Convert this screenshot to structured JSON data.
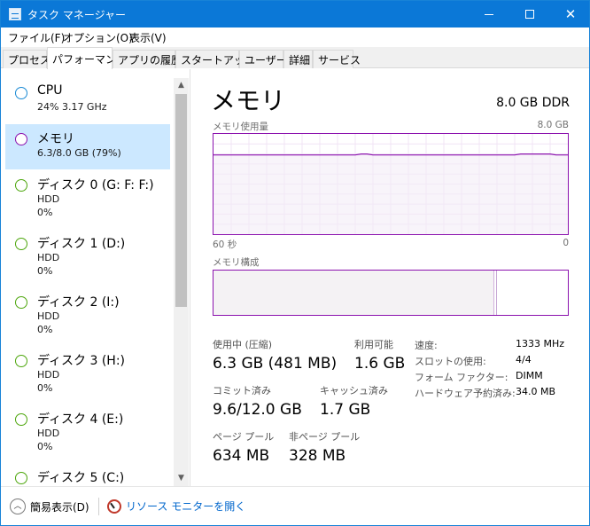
{
  "window": {
    "title": "タスク マネージャー",
    "close_glyph": "✕"
  },
  "menu": [
    "ファイル(F)",
    "オプション(O)",
    "表示(V)"
  ],
  "tabs": [
    "プロセス",
    "パフォーマンス",
    "アプリの履歴",
    "スタートアップ",
    "ユーザー",
    "詳細",
    "サービス"
  ],
  "active_tab": "パフォーマンス",
  "sidebar": {
    "items": [
      {
        "title": "CPU",
        "sub1": "24%  3.17 GHz",
        "sub2": "",
        "color": "#1a8ad4",
        "selected": false
      },
      {
        "title": "メモリ",
        "sub1": "6.3/8.0 GB (79%)",
        "sub2": "",
        "color": "#8b12ae",
        "selected": true
      },
      {
        "title": "ディスク 0 (G: F: F:)",
        "sub1": "HDD",
        "sub2": "0%",
        "color": "#4da60c",
        "selected": false
      },
      {
        "title": "ディスク 1 (D:)",
        "sub1": "HDD",
        "sub2": "0%",
        "color": "#4da60c",
        "selected": false
      },
      {
        "title": "ディスク 2 (I:)",
        "sub1": "HDD",
        "sub2": "0%",
        "color": "#4da60c",
        "selected": false
      },
      {
        "title": "ディスク 3 (H:)",
        "sub1": "HDD",
        "sub2": "0%",
        "color": "#4da60c",
        "selected": false
      },
      {
        "title": "ディスク 4 (E:)",
        "sub1": "HDD",
        "sub2": "0%",
        "color": "#4da60c",
        "selected": false
      },
      {
        "title": "ディスク 5 (C:)",
        "sub1": "",
        "sub2": "",
        "color": "#4da60c",
        "selected": false
      }
    ],
    "scroll_up": "▲",
    "scroll_down": "▼"
  },
  "memory": {
    "title": "メモリ",
    "spec": "8.0 GB DDR",
    "usage_label": "メモリ使用量",
    "usage_max": "8.0 GB",
    "time_left": "60 秒",
    "time_right": "0",
    "composition_label": "メモリ構成",
    "in_use_label": "使用中 (圧縮)",
    "in_use_value": "6.3 GB (481 MB)",
    "available_label": "利用可能",
    "available_value": "1.6 GB",
    "committed_label": "コミット済み",
    "committed_value": "9.6/12.0 GB",
    "cached_label": "キャッシュ済み",
    "cached_value": "1.7 GB",
    "paged_label": "ページ プール",
    "paged_value": "634 MB",
    "nonpaged_label": "非ページ プール",
    "nonpaged_value": "328 MB",
    "details": [
      {
        "key": "速度:",
        "value": "1333 MHz"
      },
      {
        "key": "スロットの使用:",
        "value": "4/4"
      },
      {
        "key": "フォーム ファクター:",
        "value": "DIMM"
      },
      {
        "key": "ハードウェア予約済み:",
        "value": "34.0 MB"
      }
    ],
    "accent_color": "#8b12ae",
    "composition_in_use_fraction": 0.79,
    "history_fraction": [
      0.79,
      0.79,
      0.79,
      0.79,
      0.79,
      0.79,
      0.79,
      0.79,
      0.79,
      0.79,
      0.79,
      0.79,
      0.79,
      0.79,
      0.79,
      0.79,
      0.79,
      0.79,
      0.79,
      0.79,
      0.79,
      0.79,
      0.79,
      0.79,
      0.79,
      0.8,
      0.8,
      0.79,
      0.79,
      0.79,
      0.79,
      0.79,
      0.79,
      0.79,
      0.79,
      0.79,
      0.79,
      0.79,
      0.79,
      0.79,
      0.79,
      0.79,
      0.79,
      0.79,
      0.79,
      0.79,
      0.79,
      0.79,
      0.79,
      0.79,
      0.79,
      0.79,
      0.8,
      0.8,
      0.8,
      0.8,
      0.8,
      0.8,
      0.79,
      0.79,
      0.79
    ]
  },
  "footer": {
    "fewer_details": "簡易表示(D)",
    "fewer_icon": "︿",
    "resource_monitor": "リソース モニターを開く"
  }
}
